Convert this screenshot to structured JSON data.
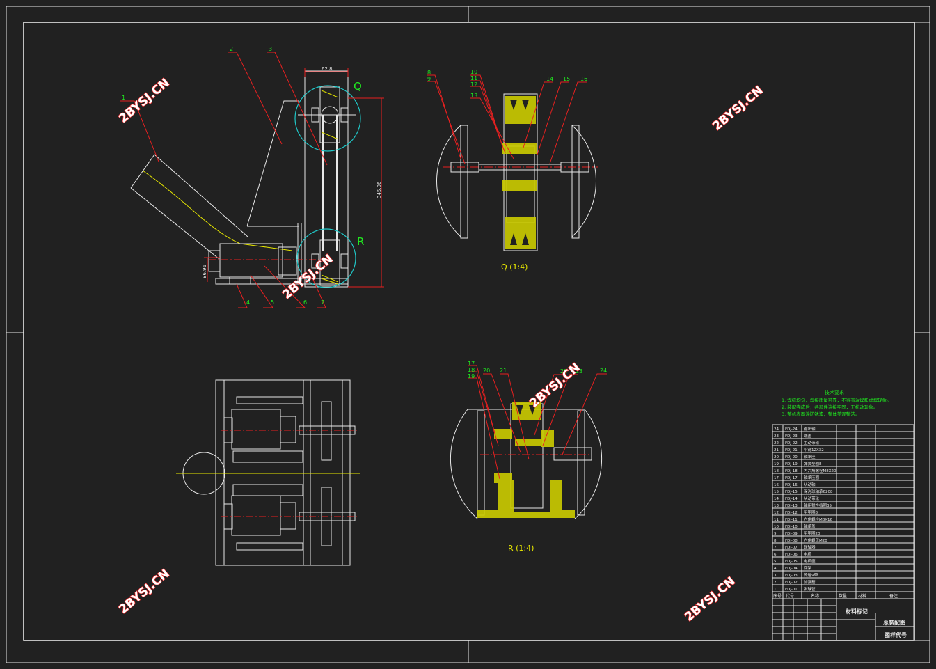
{
  "watermark": "2BYSJ.CN",
  "detail_q": {
    "marker": "Q",
    "caption": "Q (1:4)"
  },
  "detail_r": {
    "marker": "R",
    "caption": "R (1:4)"
  },
  "dimensions": {
    "top_width": "62.8",
    "overall_height": "345.96",
    "base_height": "86.96"
  },
  "callouts_main": [
    "1",
    "2",
    "3",
    "4",
    "5",
    "6",
    "7"
  ],
  "callouts_q": [
    "8",
    "9",
    "10",
    "11",
    "12",
    "13",
    "14",
    "15",
    "16"
  ],
  "callouts_r": [
    "17",
    "18",
    "19",
    "20",
    "21",
    "22",
    "23",
    "24"
  ],
  "tech_requirements": {
    "title": "技术要求",
    "items": [
      "1. 焊缝均匀，焊接质量可靠，不得有漏焊和虚焊现象。",
      "2. 装配完成后，各部件连接牢固，无松动现象。",
      "3. 整机表面涂防锈漆，整体美观整洁。"
    ]
  },
  "bom": {
    "headers": [
      "序号",
      "代号",
      "名称",
      "数量",
      "材料",
      "备注"
    ],
    "rows": [
      [
        "24",
        "FDJ-24",
        "输出轴"
      ],
      [
        "23",
        "FDJ-23",
        "端盖"
      ],
      [
        "22",
        "FDJ-22",
        "主动带轮"
      ],
      [
        "21",
        "FDJ-21",
        "平键12X32"
      ],
      [
        "20",
        "FDJ-20",
        "轴承座"
      ],
      [
        "19",
        "FDJ-19",
        "弹簧垫圈8"
      ],
      [
        "18",
        "FDJ-18",
        "内六角螺栓M8X20"
      ],
      [
        "17",
        "FDJ-17",
        "轴承压圈"
      ],
      [
        "16",
        "FDJ-16",
        "从动轴"
      ],
      [
        "15",
        "FDJ-15",
        "深沟球轴承6208"
      ],
      [
        "14",
        "FDJ-14",
        "从动带轮"
      ],
      [
        "13",
        "FDJ-13",
        "轴用弹性挡圈35"
      ],
      [
        "12",
        "FDJ-12",
        "平垫圈8"
      ],
      [
        "11",
        "FDJ-11",
        "六角螺栓M8X16"
      ],
      [
        "10",
        "FDJ-10",
        "轴承盖"
      ],
      [
        "9",
        "FDJ-09",
        "平垫圈20"
      ],
      [
        "8",
        "FDJ-08",
        "六角螺母M20"
      ],
      [
        "7",
        "FDJ-07",
        "联轴器"
      ],
      [
        "6",
        "FDJ-06",
        "电机"
      ],
      [
        "5",
        "FDJ-05",
        "电机座"
      ],
      [
        "4",
        "FDJ-04",
        "底架"
      ],
      [
        "3",
        "FDJ-03",
        "传送V带"
      ],
      [
        "2",
        "FDJ-02",
        "加强筋"
      ],
      [
        "1",
        "FDJ-01",
        "发球管"
      ]
    ]
  },
  "title_block": {
    "material": "材料标记",
    "drawing_name": "总装配图",
    "drawing_code": "图样代号"
  }
}
